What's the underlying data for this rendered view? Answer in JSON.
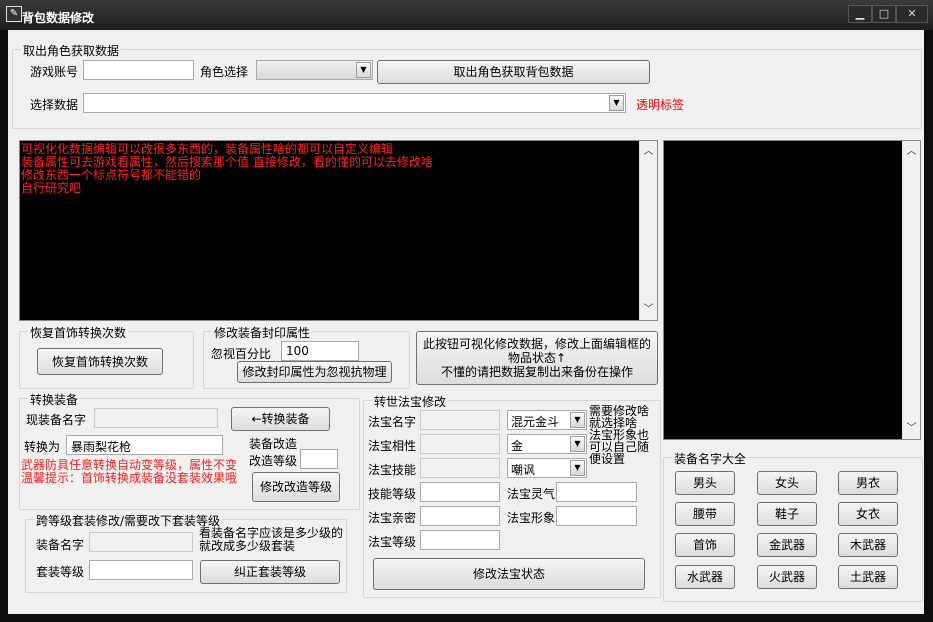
{
  "window": {
    "title": "背包数据修改",
    "minimize": "▁",
    "maximize": "□",
    "close": "✕"
  },
  "fetch_group": {
    "label": "取出角色获取数据",
    "account_label": "游戏账号",
    "account_value": "",
    "role_label": "角色选择",
    "role_value": "",
    "fetch_button": "取出角色获取背包数据",
    "select_label": "选择数据",
    "select_value": "",
    "transparent_label": "透明标签"
  },
  "editor": {
    "lines": [
      "可视化化数据编辑可以改很多东西的，装备属性啥的都可以自定义编辑",
      "装备属性可去游戏看属性，然后搜索那个值 直接修改，看的懂的可以去修改啥",
      "修改东西一个标点符号都不能错的",
      "自行研究吧"
    ]
  },
  "restore_group": {
    "label": "恢复首饰转换次数",
    "button": "恢复首饰转换次数"
  },
  "seal_group": {
    "label": "修改装备封印属性",
    "ignore_label": "忽视百分比",
    "ignore_value": "100",
    "button": "修改封印属性为忽视抗物理"
  },
  "visual_button": {
    "line1": "此按钮可视化修改数据，修改上面编辑框的",
    "line2": "物品状态↑",
    "line3": "不懂的请把数据复制出来备份在操作"
  },
  "convert_group": {
    "label": "转换装备",
    "current_label": "现装备名字",
    "current_value": "",
    "convert_button": "←转换装备",
    "to_label": "转换为",
    "to_value": "暴雨梨花枪",
    "upgrade_label": "装备改造",
    "upgrade_level_label": "改造等级",
    "upgrade_level_value": "",
    "upgrade_button": "修改改造等级",
    "warning_line1": "武器防具任意转换自动变等级，属性不变",
    "warning_line2": "温馨提示：首饰转换成装备没套装效果哦"
  },
  "set_group": {
    "label": "跨等级套装修改/需要改下套装等级",
    "name_label": "装备名字",
    "name_value": "",
    "hint_line1": "看装备名字应该是多少级的",
    "hint_line2": "就改成多少级套装",
    "level_label": "套装等级",
    "level_value": "",
    "button": "纠正套装等级"
  },
  "treasure_group": {
    "label": "转世法宝修改",
    "name_label": "法宝名字",
    "name_value": "",
    "name_combo": "混元金斗",
    "attr_label": "法宝相性",
    "attr_value": "",
    "attr_combo": "金",
    "skill_label": "法宝技能",
    "skill_value": "",
    "skill_combo": "嘲讽",
    "skill_level_label": "技能等级",
    "skill_level_value": "",
    "spirit_label": "法宝灵气",
    "spirit_value": "",
    "intimacy_label": "法宝亲密",
    "intimacy_value": "",
    "form_label": "法宝形象",
    "form_value": "",
    "level_label": "法宝等级",
    "level_value": "",
    "hint_line1": "需要修改啥",
    "hint_line2": "就选择啥",
    "hint_line3": "法宝形象也",
    "hint_line4": "可以自己随",
    "hint_line5": "便设置",
    "button": "修改法宝状态"
  },
  "equip_names": {
    "label": "装备名字大全",
    "buttons": [
      "男头",
      "女头",
      "男衣",
      "腰带",
      "鞋子",
      "女衣",
      "首饰",
      "金武器",
      "木武器",
      "水武器",
      "火武器",
      "土武器"
    ]
  }
}
